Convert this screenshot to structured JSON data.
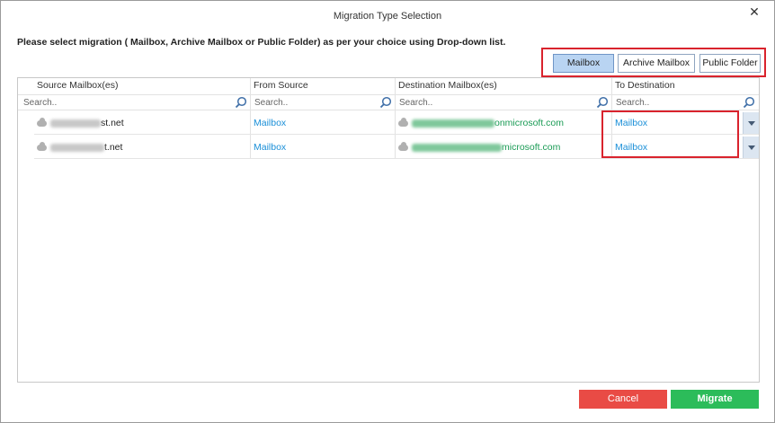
{
  "window": {
    "title": "Migration Type Selection",
    "close_glyph": "✕"
  },
  "instruction": "Please select migration ( Mailbox, Archive Mailbox or Public Folder) as per your choice using Drop-down list.",
  "migration_types": {
    "mailbox": "Mailbox",
    "archive_mailbox": "Archive Mailbox",
    "public_folder": "Public Folder",
    "selected": "Mailbox"
  },
  "grid": {
    "columns": {
      "source": "Source Mailbox(es)",
      "from_source": "From Source",
      "destination": "Destination Mailbox(es)",
      "to_destination": "To Destination"
    },
    "search_placeholder": "Search..",
    "rows": [
      {
        "source_suffix": "st.net",
        "from_source": "Mailbox",
        "destination_suffix": "onmicrosoft.com",
        "to_destination": "Mailbox"
      },
      {
        "source_suffix": "t.net",
        "from_source": "Mailbox",
        "destination_suffix": "microsoft.com",
        "to_destination": "Mailbox"
      }
    ]
  },
  "footer": {
    "cancel": "Cancel",
    "migrate": "Migrate"
  },
  "colors": {
    "highlight_border": "#d9232d",
    "cancel": "#e94b45",
    "migrate": "#2cbc5a",
    "link": "#1a8fd8",
    "destination_text": "#1a9b55"
  }
}
